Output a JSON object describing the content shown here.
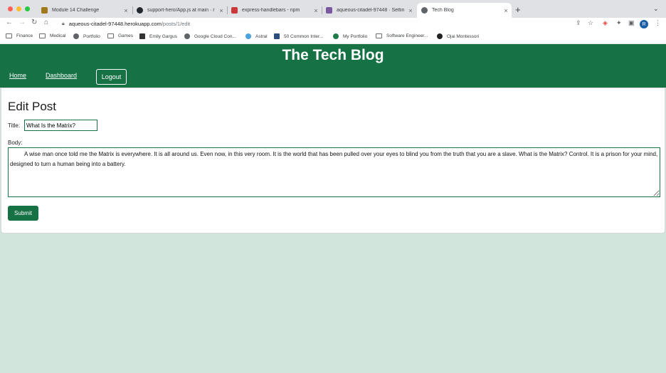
{
  "browser": {
    "tabs": [
      {
        "title": "Module 14 Challenge",
        "icon": "module-icon",
        "active": false
      },
      {
        "title": "support-hero/App.js at main · r",
        "icon": "github-icon",
        "active": false
      },
      {
        "title": "express-handlebars - npm",
        "icon": "npm-icon",
        "active": false
      },
      {
        "title": "aqueous-citadel-97448 · Settin",
        "icon": "heroku-icon",
        "active": false
      },
      {
        "title": "Tech Blog",
        "icon": "globe-icon",
        "active": true
      }
    ],
    "url_host": "aqueous-citadel-97448.herokuapp.com",
    "url_path": "/posts/1/edit",
    "profile_initial": "R",
    "bookmarks": [
      {
        "label": "Finance",
        "icon": "folder-icon"
      },
      {
        "label": "Medical",
        "icon": "folder-icon"
      },
      {
        "label": "Portfolio",
        "icon": "globe-icon"
      },
      {
        "label": "Games",
        "icon": "folder-icon"
      },
      {
        "label": "Emily Gargus",
        "icon": "bookmark-icon"
      },
      {
        "label": "Google Cloud Con...",
        "icon": "globe-icon"
      },
      {
        "label": "Astral",
        "icon": "bookmark-icon"
      },
      {
        "label": "50 Common Inter...",
        "icon": "bookmark-icon"
      },
      {
        "label": "My Portfolio",
        "icon": "bookmark-icon"
      },
      {
        "label": "Software Engineer...",
        "icon": "folder-icon"
      },
      {
        "label": "Ojai Montessori",
        "icon": "bookmark-icon"
      }
    ]
  },
  "site": {
    "title": "The Tech Blog",
    "nav": {
      "home": "Home",
      "dashboard": "Dashboard",
      "logout": "Logout"
    }
  },
  "form": {
    "heading": "Edit Post",
    "title_label": "Title:",
    "title_value": "What Is the Matrix?",
    "body_label": "Body:",
    "body_value": "A wise man once told me the Matrix is everywhere. It is all around us. Even now, in this very room. It is the world that has been pulled over your eyes to blind you from the truth that you are a slave. What is the Matrix? Control. It is a prison for your mind, designed to turn a human being into a battery.",
    "submit_label": "Submit"
  },
  "colors": {
    "brand_green": "#167145",
    "page_background": "#d2e5dd"
  }
}
